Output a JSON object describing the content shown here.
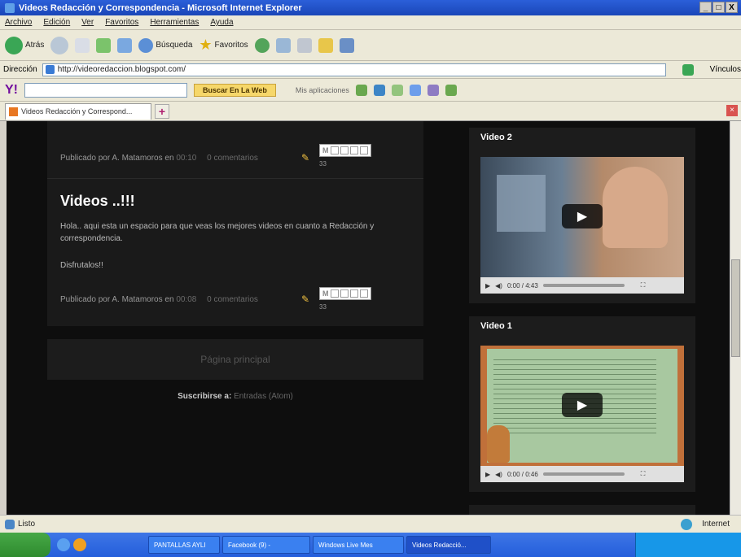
{
  "window": {
    "title": "Videos Redacción y Correspondencia - Microsoft Internet Explorer",
    "min": "_",
    "max": "□",
    "close": "X"
  },
  "menu": [
    "Archivo",
    "Edición",
    "Ver",
    "Favoritos",
    "Herramientas",
    "Ayuda"
  ],
  "toolbar": {
    "back": "Atrás",
    "search": "Búsqueda",
    "favorites": "Favoritos"
  },
  "address": {
    "label": "Dirección",
    "url": "http://videoredaccion.blogspot.com/",
    "links": "Vínculos"
  },
  "yahoo": {
    "logo": "Y!",
    "search_btn": "Buscar En La Web",
    "apps": "Mis aplicaciones"
  },
  "tab": {
    "label": "Videos Redacción y Correspond..."
  },
  "page": {
    "post1_meta_prefix": "Publicado por A. Matamoros en",
    "post1_time": "00:10",
    "post1_comments": "0 comentarios",
    "post1_count": "33",
    "post2_title": "Videos ..!!!",
    "post2_body": "Hola.. aqui esta un espacio para que veas los mejores videos en cuanto a Redacción y correspondencia.",
    "post2_body2": "Disfrutalos!!",
    "post2_meta_prefix": "Publicado por A. Matamoros en",
    "post2_time": "00:08",
    "post2_comments": "0 comentarios",
    "post2_count": "33",
    "pager": "Página principal",
    "subscribe_prefix": "Suscribirse a:",
    "subscribe_link": "Entradas (Atom)"
  },
  "sidebar": {
    "video2_title": "Video 2",
    "video2_time": "0:00 / 4:43",
    "video1_title": "Video 1",
    "video1_time": "0:00 / 0:46"
  },
  "status": {
    "left": "Listo",
    "zone": "Internet"
  },
  "taskbar": {
    "items": [
      "PANTALLAS AYLI",
      "Facebook (9) -",
      "Windows Live Mes",
      "Videos Redacció..."
    ]
  },
  "colors": {
    "page_bg": "#0e0e0e",
    "post_bg": "#1a1a1a",
    "title_bar": "#2b5fd9",
    "taskbar": "#245edb"
  }
}
